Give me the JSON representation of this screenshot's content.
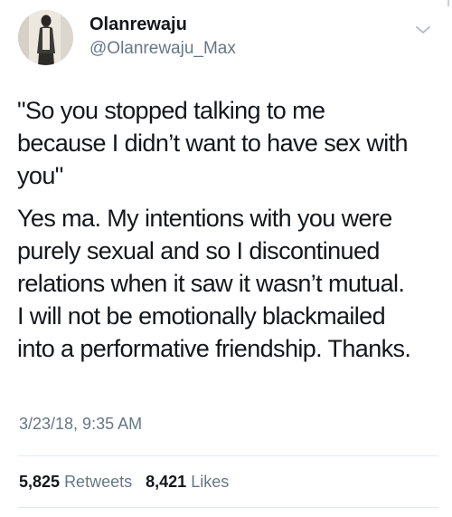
{
  "tweet": {
    "author": {
      "display_name": "Olanrewaju",
      "handle": "@Olanrewaju_Max",
      "avatar_icon": "user-avatar-icon"
    },
    "menu_icon": "chevron-down-icon",
    "paragraphs": [
      "\"So you stopped talking to me\nbecause I didn’t want to have sex with\nyou\"",
      "Yes ma. My intentions with you were\npurely sexual and so I discontinued\nrelations when it saw it wasn’t mutual.\nI will not be emotionally blackmailed\ninto a performative friendship. Thanks."
    ],
    "timestamp": "3/23/18, 9:35 AM",
    "stats": {
      "retweets_count": "5,825",
      "retweets_label": "Retweets",
      "likes_count": "8,421",
      "likes_label": "Likes"
    }
  },
  "colors": {
    "text": "#14171a",
    "secondary": "#657786",
    "divider": "#e1e8ed"
  }
}
